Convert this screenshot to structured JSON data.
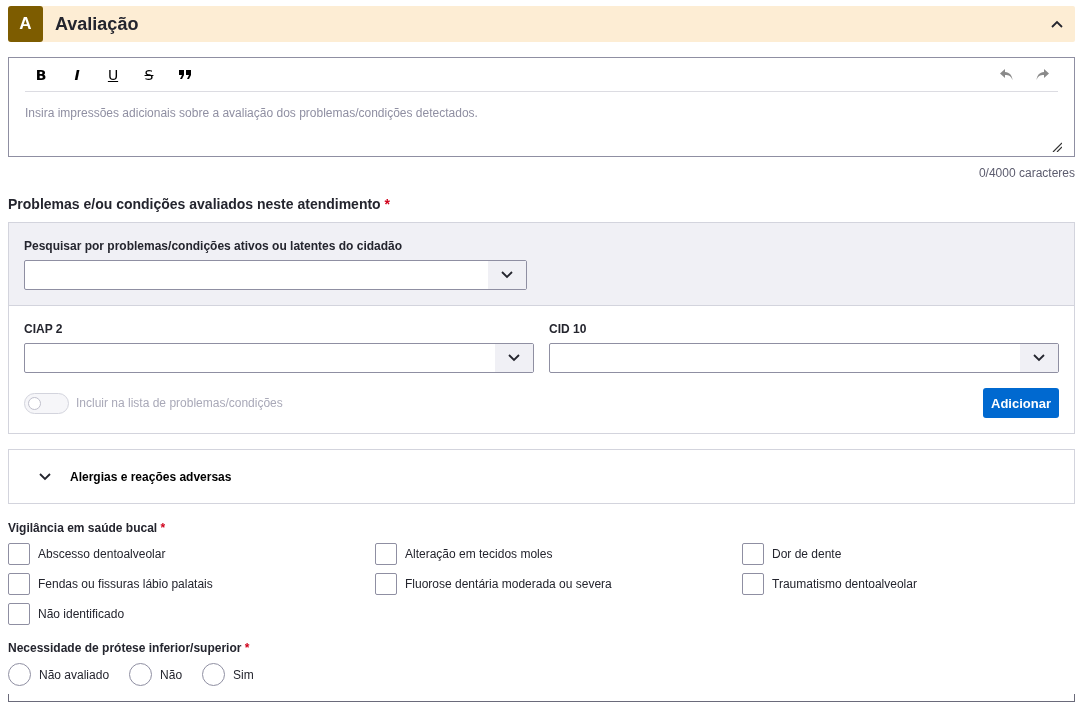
{
  "section": {
    "letter": "A",
    "title": "Avaliação",
    "expanded": true
  },
  "editor": {
    "toolbar": [
      {
        "kind": "bold",
        "label": "B"
      },
      {
        "kind": "italic",
        "label": "I"
      },
      {
        "kind": "underline",
        "label": "U"
      },
      {
        "kind": "strike",
        "label": "S"
      }
    ],
    "placeholder": "Insira impressões adicionais sobre a avaliação dos problemas/condições detectados.",
    "counter": "0/4000 caracteres"
  },
  "problems": {
    "title": "Problemas e/ou condições avaliados neste atendimento",
    "required_mark": "*",
    "search_label": "Pesquisar por problemas/condições ativos ou latentes do cidadão",
    "ciap_label": "CIAP 2",
    "cid_label": "CID 10",
    "toggle": {
      "label": "Incluir na lista de problemas/condições",
      "on": false,
      "disabled": true
    },
    "add_button": "Adicionar"
  },
  "allergies": {
    "title": "Alergias e reações adversas",
    "expanded": false
  },
  "vigilance": {
    "title": "Vigilância em saúde bucal",
    "required_mark": "*",
    "options": [
      {
        "label": "Abscesso dentoalveolar",
        "checked": false
      },
      {
        "label": "Alteração em tecidos moles",
        "checked": false
      },
      {
        "label": "Dor de dente",
        "checked": false
      },
      {
        "label": "Fendas ou fissuras lábio palatais",
        "checked": false
      },
      {
        "label": "Fluorose dentária moderada ou severa",
        "checked": false
      },
      {
        "label": "Traumatismo dentoalveolar",
        "checked": false
      },
      {
        "label": "Não identificado",
        "checked": false
      }
    ]
  },
  "prosthesis": {
    "title": "Necessidade de prótese inferior/superior",
    "required_mark": "*",
    "options": [
      {
        "label": "Não avaliado",
        "selected": false
      },
      {
        "label": "Não",
        "selected": false
      },
      {
        "label": "Sim",
        "selected": false
      }
    ]
  }
}
